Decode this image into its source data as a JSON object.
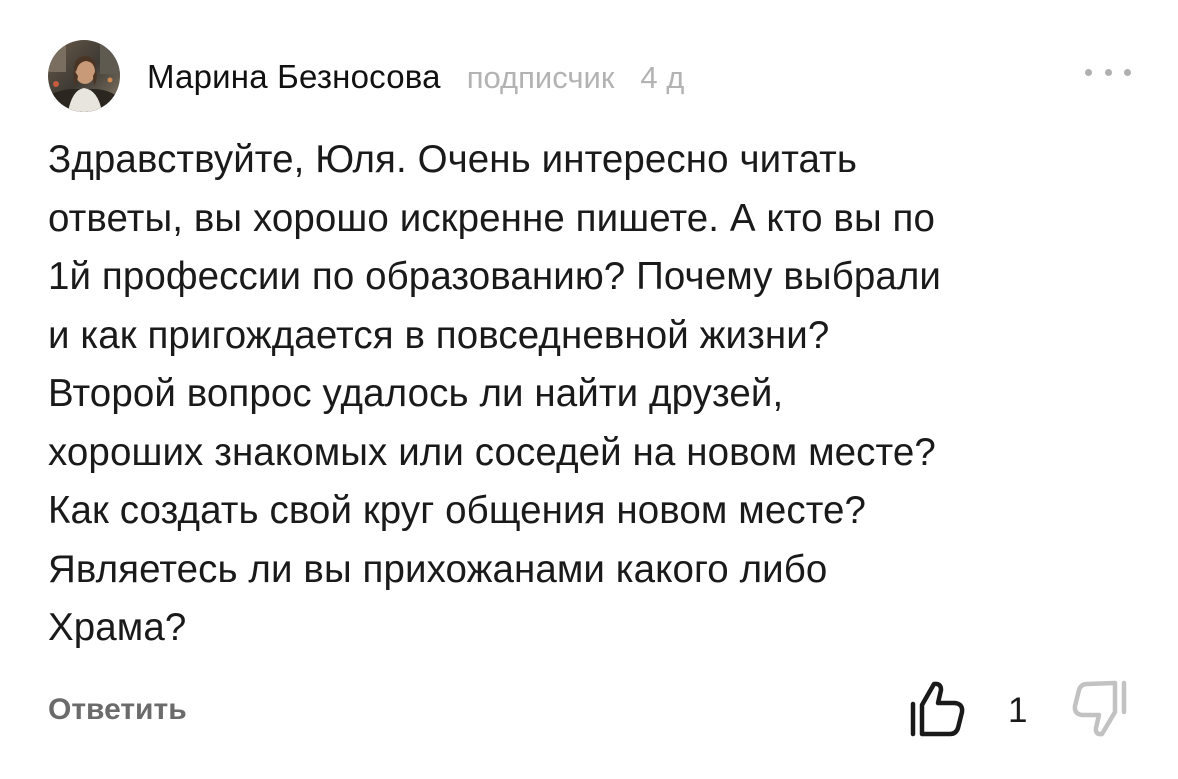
{
  "comment": {
    "author": "Марина Безносова",
    "role": "подписчик",
    "time": "4 д",
    "text": "Здравствуйте, Юля. Очень интересно читать\nответы, вы хорошо искренне пишете. А кто вы по\n1й профессии по образованию? Почему выбрали\nи как пригождается в повседневной жизни?\nВторой вопрос удалось ли найти друзей,\nхороших знакомых или соседей на новом месте?\nКак создать свой круг общения новом месте?\nЯвляетесь ли вы прихожанами какого либо\nХрама?",
    "reply_label": "Ответить",
    "like_count": "1",
    "icons": {
      "more": "more-horizontal-icon",
      "like": "thumbs-up-icon",
      "dislike": "thumbs-down-icon"
    },
    "colors": {
      "text": "#1a1a1a",
      "muted": "#b3b3b3",
      "reply": "#6b6b6b"
    }
  }
}
